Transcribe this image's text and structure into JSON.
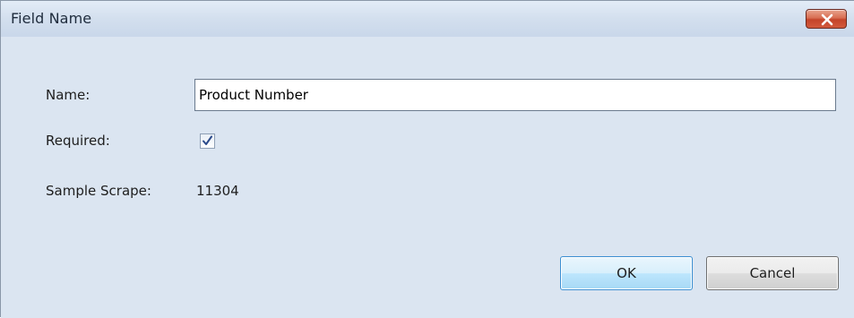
{
  "dialog": {
    "title": "Field Name",
    "close_icon": "close-x-icon"
  },
  "form": {
    "name_label": "Name:",
    "name_value": "Product Number",
    "required_label": "Required:",
    "required_checked": true,
    "sample_label": "Sample Scrape:",
    "sample_value": "11304"
  },
  "buttons": {
    "ok_label": "OK",
    "cancel_label": "Cancel"
  },
  "colors": {
    "client_background": "#dbe5f1",
    "close_button": "#c4442a",
    "ok_button_border": "#3c8fd1"
  }
}
